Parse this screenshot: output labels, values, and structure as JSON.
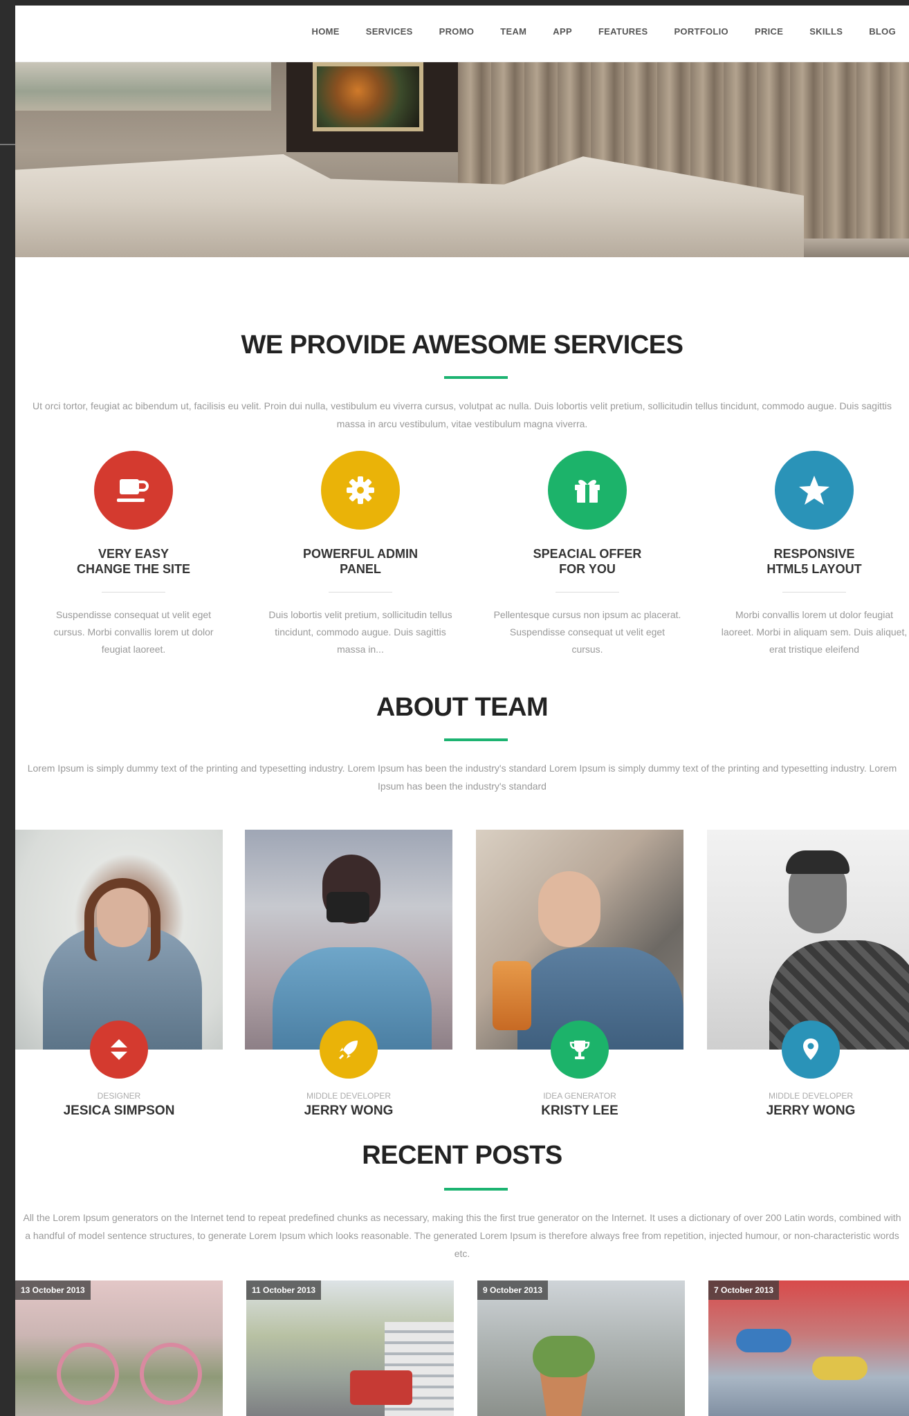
{
  "nav": {
    "items": [
      "HOME",
      "SERVICES",
      "PROMO",
      "TEAM",
      "APP",
      "FEATURES",
      "PORTFOLIO",
      "PRICE",
      "SKILLS",
      "BLOG"
    ]
  },
  "services": {
    "title": "WE PROVIDE AWESOME SERVICES",
    "lead": "Ut orci tortor, feugiat ac bibendum ut, facilisis eu velit. Proin dui nulla, vestibulum eu viverra cursus, volutpat ac nulla. Duis lobortis velit pretium, sollicitudin tellus tincidunt, commodo augue. Duis sagittis massa in arcu vestibulum, vitae vestibulum magna viverra.",
    "items": [
      {
        "title_line1": "VERY EASY",
        "title_line2": "CHANGE THE SITE",
        "desc": "Suspendisse consequat ut velit eget cursus. Morbi convallis lorem ut dolor feugiat laoreet.",
        "icon": "coffee-cup-icon",
        "color": "#d43a2f"
      },
      {
        "title_line1": "POWERFUL ADMIN",
        "title_line2": "PANEL",
        "desc": "Duis lobortis velit pretium, sollicitudin tellus tincidunt, commodo augue. Duis sagittis massa in...",
        "icon": "gear-icon",
        "color": "#eab308"
      },
      {
        "title_line1": "SPEACIAL OFFER",
        "title_line2": "FOR YOU",
        "desc": "Pellentesque cursus non ipsum ac placerat. Suspendisse consequat ut velit eget cursus.",
        "icon": "gift-icon",
        "color": "#1cb36a"
      },
      {
        "title_line1": "RESPONSIVE",
        "title_line2": "HTML5 LAYOUT",
        "desc": "Morbi convallis lorem ut dolor feugiat laoreet. Morbi in aliquam sem. Duis aliquet, erat tristique eleifend",
        "icon": "star-icon",
        "color": "#2a93b8"
      }
    ]
  },
  "team": {
    "title": "ABOUT TEAM",
    "lead": "Lorem Ipsum is simply dummy text of the printing and typesetting industry. Lorem Ipsum has been the industry's standard Lorem Ipsum is simply dummy text of the printing and typesetting industry. Lorem Ipsum has been the industry's standard",
    "members": [
      {
        "role": "DESIGNER",
        "name": "JESICA SIMPSON",
        "icon": "sort-arrows-icon",
        "color": "#d43a2f"
      },
      {
        "role": "MIDDLE DEVELOPER",
        "name": "JERRY WONG",
        "icon": "rocket-icon",
        "color": "#eab308"
      },
      {
        "role": "IDEA GENERATOR",
        "name": "KRISTY LEE",
        "icon": "trophy-icon",
        "color": "#1cb36a"
      },
      {
        "role": "MIDDLE DEVELOPER",
        "name": "JERRY WONG",
        "icon": "map-pin-icon",
        "color": "#2a93b8"
      }
    ]
  },
  "posts": {
    "title": "RECENT POSTS",
    "lead": "All the Lorem Ipsum generators on the Internet tend to repeat predefined chunks as necessary, making this the first true generator on the Internet. It uses a dictionary of over 200 Latin words, combined with a handful of model sentence structures, to generate Lorem Ipsum which looks reasonable. The generated Lorem Ipsum is therefore always free from repetition, injected humour, or non-characteristic words etc.",
    "items": [
      {
        "date": "13 October 2013"
      },
      {
        "date": "11 October 2013"
      },
      {
        "date": "9 October 2013"
      },
      {
        "date": "7 October 2013"
      }
    ]
  },
  "colors": {
    "accent": "#1cb371",
    "red": "#d43a2f",
    "yellow": "#eab308",
    "green": "#1cb36a",
    "blue": "#2a93b8"
  }
}
